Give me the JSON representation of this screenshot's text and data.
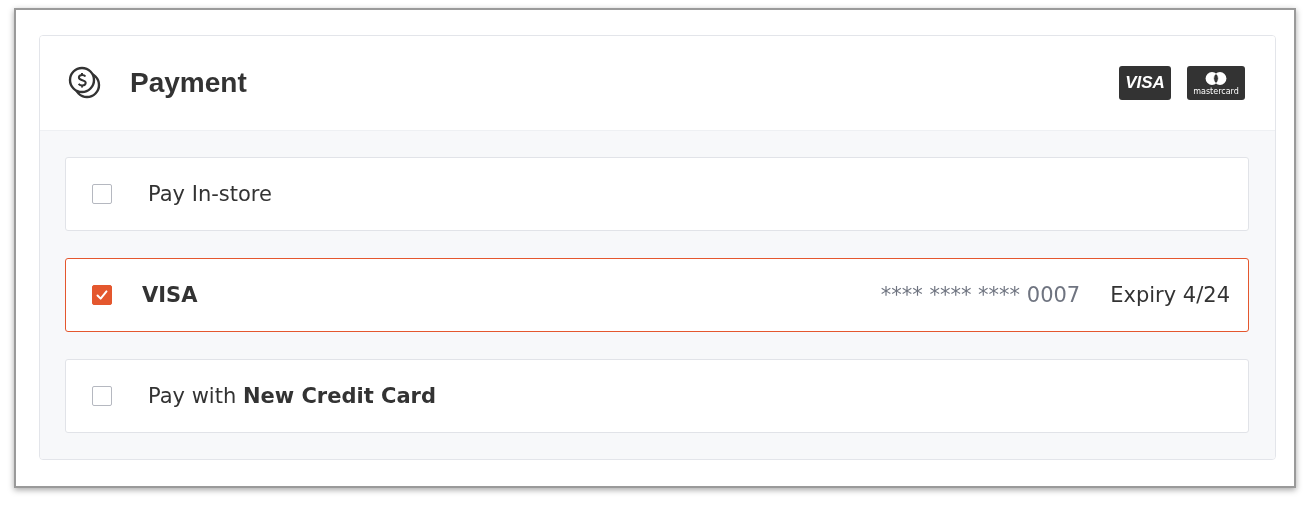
{
  "header": {
    "title": "Payment",
    "card_logos": [
      {
        "kind": "visa",
        "text": "VISA"
      },
      {
        "kind": "mastercard",
        "text": "mastercard"
      }
    ]
  },
  "options": [
    {
      "label": "Pay In-store",
      "checked": false,
      "selected": false
    },
    {
      "label": "**VISA**",
      "checked": true,
      "selected": true,
      "card_number": "**** **** **** 0007",
      "expiry": "Expiry 4/24"
    },
    {
      "label": "Pay with **New Credit Card**",
      "checked": false,
      "selected": false
    }
  ]
}
